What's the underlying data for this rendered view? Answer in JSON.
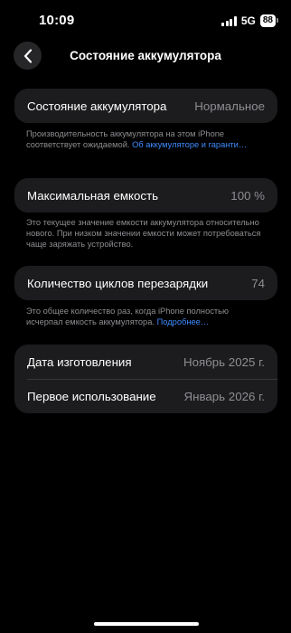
{
  "status_bar": {
    "time": "10:09",
    "network": "5G",
    "battery_level": "88"
  },
  "nav": {
    "title": "Состояние аккумулятора"
  },
  "health": {
    "label": "Состояние аккумулятора",
    "value": "Нормальное",
    "note": "Производительность аккумулятора на этом iPhone соответствует ожидаемой.",
    "link": "Об аккумуляторе и гаранти…"
  },
  "capacity": {
    "label": "Максимальная емкость",
    "value": "100 %",
    "note": "Это текущее значение емкости аккумулятора относительно нового. При низком значении емкости может потребоваться чаще заряжать устройство."
  },
  "cycles": {
    "label": "Количество циклов перезарядки",
    "value": "74",
    "note": "Это общее количество раз, когда iPhone полностью исчерпал емкость аккумулятора.",
    "link": "Подробнее…"
  },
  "dates": {
    "manufacture_label": "Дата изготовления",
    "manufacture_value": "Ноябрь 2025 г.",
    "first_use_label": "Первое использование",
    "first_use_value": "Январь 2026 г."
  },
  "colors": {
    "background": "#000000",
    "card": "#1c1c1e",
    "secondary_text": "#8e8e93",
    "link": "#3f8cff"
  }
}
